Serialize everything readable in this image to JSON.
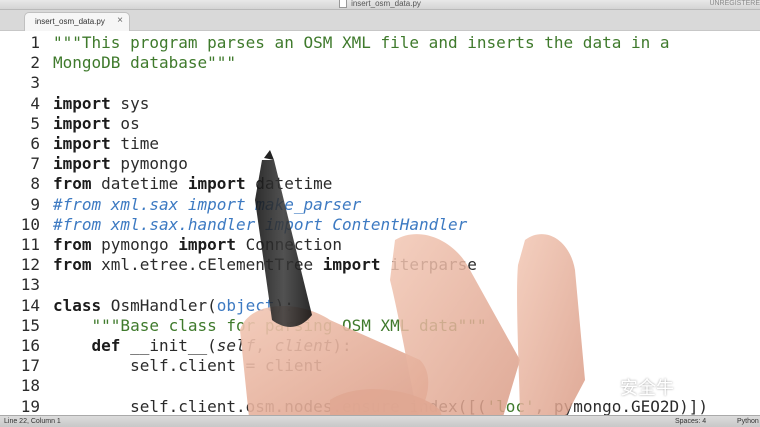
{
  "window": {
    "title": "insert_osm_data.py",
    "unregistered": "UNREGISTERE"
  },
  "tab": {
    "label": "insert_osm_data.py",
    "close": "×"
  },
  "code_lines": [
    {
      "n": "1",
      "parts": [
        [
          "str",
          "\"\"\"This program parses an OSM XML file and inserts the data in a"
        ]
      ]
    },
    {
      "n": "2",
      "parts": [
        [
          "str",
          "MongoDB database\"\"\""
        ]
      ]
    },
    {
      "n": "3",
      "parts": []
    },
    {
      "n": "4",
      "parts": [
        [
          "kw",
          "import"
        ],
        [
          "txt",
          " sys"
        ]
      ]
    },
    {
      "n": "5",
      "parts": [
        [
          "kw",
          "import"
        ],
        [
          "txt",
          " os"
        ]
      ]
    },
    {
      "n": "6",
      "parts": [
        [
          "kw",
          "import"
        ],
        [
          "txt",
          " time"
        ]
      ]
    },
    {
      "n": "7",
      "parts": [
        [
          "kw",
          "import"
        ],
        [
          "txt",
          " pymongo"
        ]
      ]
    },
    {
      "n": "8",
      "parts": [
        [
          "kw",
          "from"
        ],
        [
          "txt",
          " datetime "
        ],
        [
          "kw",
          "import"
        ],
        [
          "txt",
          " datetime"
        ]
      ]
    },
    {
      "n": "9",
      "parts": [
        [
          "com",
          "#from xml.sax import make_parser"
        ]
      ]
    },
    {
      "n": "10",
      "parts": [
        [
          "com",
          "#from xml.sax.handler import ContentHandler"
        ]
      ]
    },
    {
      "n": "11",
      "parts": [
        [
          "kw",
          "from"
        ],
        [
          "txt",
          " pymongo "
        ],
        [
          "kw",
          "import"
        ],
        [
          "txt",
          " Connection"
        ]
      ]
    },
    {
      "n": "12",
      "parts": [
        [
          "kw",
          "from"
        ],
        [
          "txt",
          " xml.etree.cElementTree "
        ],
        [
          "kw",
          "import"
        ],
        [
          "txt",
          " iterparse"
        ]
      ]
    },
    {
      "n": "13",
      "parts": []
    },
    {
      "n": "14",
      "parts": [
        [
          "kw",
          "class"
        ],
        [
          "txt",
          " OsmHandler("
        ],
        [
          "bi",
          "object"
        ],
        [
          "txt",
          "):"
        ]
      ]
    },
    {
      "n": "15",
      "parts": [
        [
          "txt",
          "    "
        ],
        [
          "str",
          "\"\"\"Base class for parsing OSM XML data\"\"\""
        ]
      ]
    },
    {
      "n": "16",
      "parts": [
        [
          "txt",
          "    "
        ],
        [
          "kw",
          "def"
        ],
        [
          "txt",
          " __init__("
        ],
        [
          "param",
          "self"
        ],
        [
          "txt",
          ", "
        ],
        [
          "param",
          "client"
        ],
        [
          "txt",
          "):"
        ]
      ]
    },
    {
      "n": "17",
      "parts": [
        [
          "txt",
          "        self.client = client"
        ]
      ]
    },
    {
      "n": "18",
      "parts": []
    },
    {
      "n": "19",
      "parts": [
        [
          "txt",
          "        self.client.osm.nodes.ensure_index([("
        ],
        [
          "str",
          "'loc'"
        ],
        [
          "txt",
          ", pymongo.GEO2D)])"
        ]
      ]
    }
  ],
  "status": {
    "position": "Line 22, Column 1",
    "spaces": "Spaces: 4",
    "language": "Python"
  },
  "watermark": "安全牛"
}
